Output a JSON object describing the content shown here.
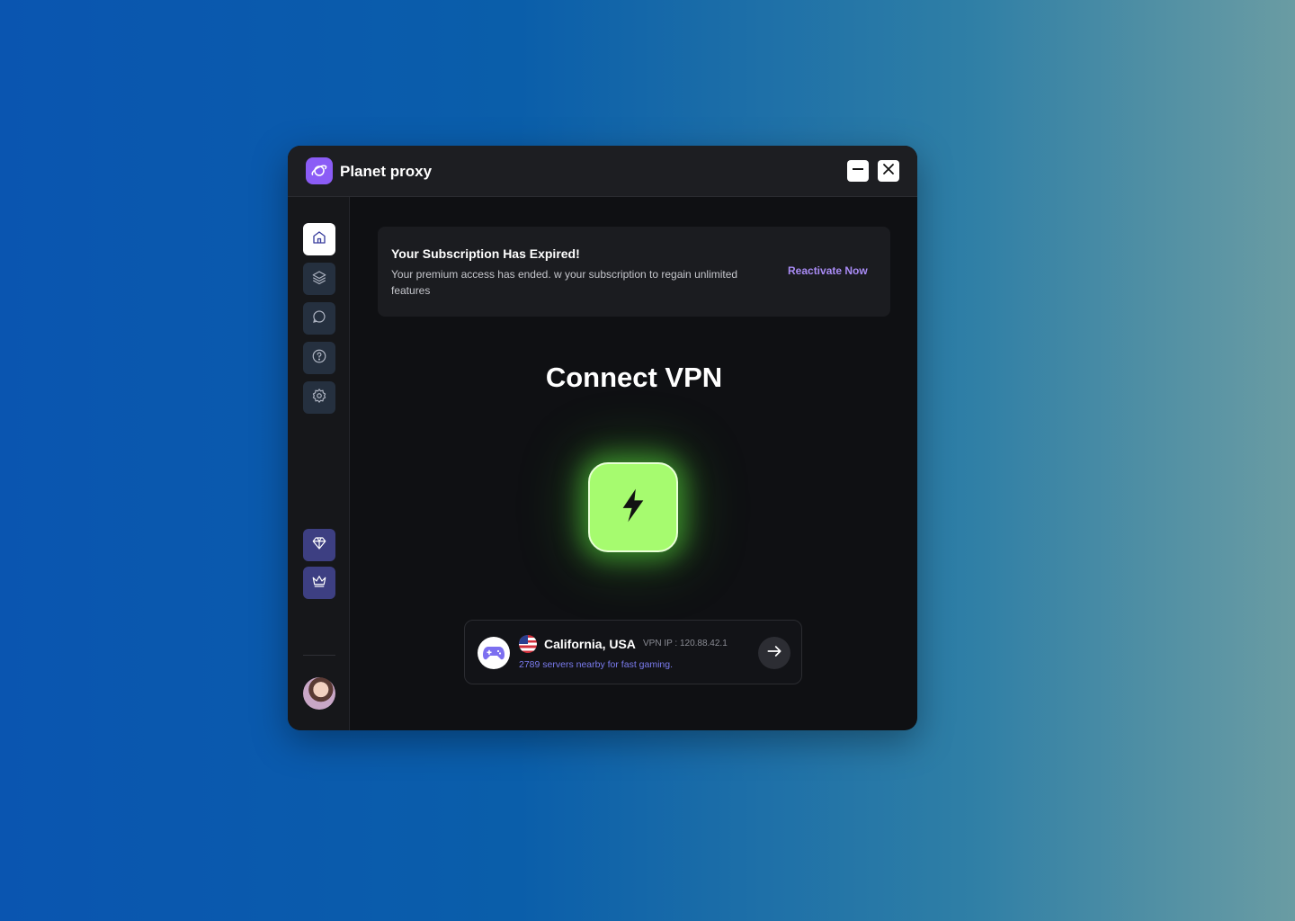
{
  "app": {
    "title": "Planet proxy",
    "accent": "#8b5cf6"
  },
  "window_controls": {
    "minimize_icon": "minimize-icon",
    "close_icon": "close-icon"
  },
  "sidebar": {
    "items": [
      {
        "icon": "home-icon",
        "active": true
      },
      {
        "icon": "layers-icon",
        "active": false
      },
      {
        "icon": "chat-icon",
        "active": false
      },
      {
        "icon": "help-icon",
        "active": false
      },
      {
        "icon": "settings-icon",
        "active": false
      }
    ],
    "premium_items": [
      {
        "icon": "diamond-icon"
      },
      {
        "icon": "crown-icon"
      }
    ],
    "avatar": "user-avatar"
  },
  "banner": {
    "title": "Your Subscription Has Expired!",
    "text": "Your premium access has ended. w your subscription to regain unlimited features",
    "action_label": "Reactivate Now"
  },
  "main": {
    "heading": "Connect VPN",
    "connect_button_icon": "lightning-icon",
    "connect_color": "#a6fb6f"
  },
  "server": {
    "icon": "gamepad-icon",
    "flag": "us-flag-icon",
    "location": "California, USA",
    "vpn_ip": "VPN IP : 120.88.42.1",
    "description": "2789 servers nearby for fast gaming.",
    "arrow_icon": "arrow-right-icon"
  }
}
